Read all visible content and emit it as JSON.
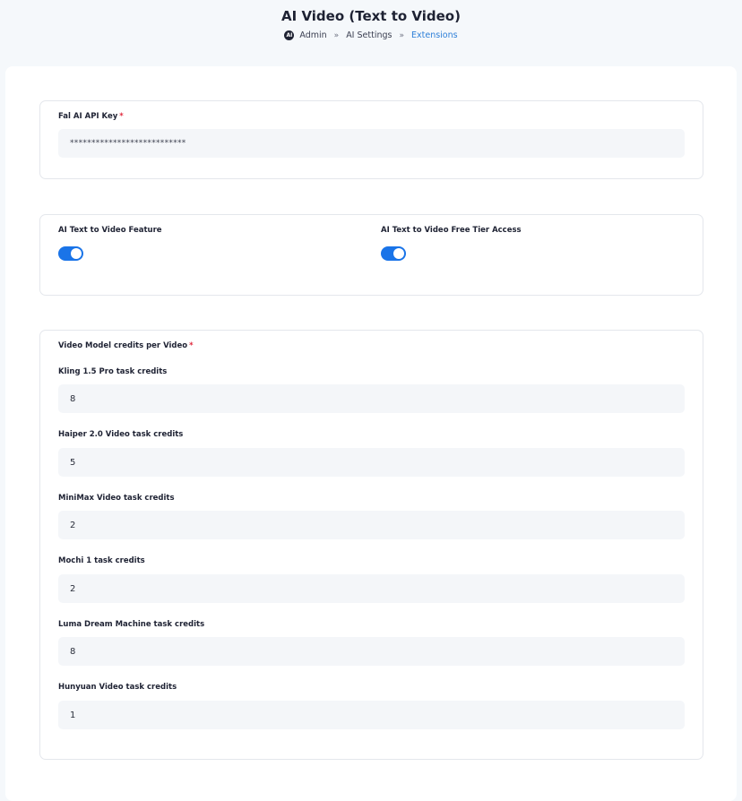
{
  "header": {
    "title": "AI Video (Text to Video)",
    "logo_text": "AI",
    "breadcrumb": [
      {
        "label": "Admin"
      },
      {
        "label": "AI Settings"
      },
      {
        "label": "Extensions"
      }
    ],
    "separator": "»"
  },
  "api_section": {
    "label": "Fal AI API Key",
    "required_mark": "*",
    "value": "***************************"
  },
  "feature_section": {
    "feature_label": "AI Text to Video Feature",
    "feature_enabled": true,
    "free_tier_label": "AI Text to Video Free Tier Access",
    "free_tier_enabled": true
  },
  "credits_section": {
    "title": "Video Model credits per Video",
    "required_mark": "*",
    "models": [
      {
        "label": "Kling 1.5 Pro task credits",
        "value": "8"
      },
      {
        "label": "Haiper 2.0 Video task credits",
        "value": "5"
      },
      {
        "label": "MiniMax Video task credits",
        "value": "2"
      },
      {
        "label": "Mochi 1 task credits",
        "value": "2"
      },
      {
        "label": "Luma Dream Machine task credits",
        "value": "8"
      },
      {
        "label": "Hunyuan Video task credits",
        "value": "1"
      }
    ]
  },
  "colors": {
    "accent": "#1a74e8",
    "link": "#2d7fd8",
    "required": "#e0283c",
    "field_bg": "#f4f6f9",
    "page_bg": "#f5f8fb"
  }
}
